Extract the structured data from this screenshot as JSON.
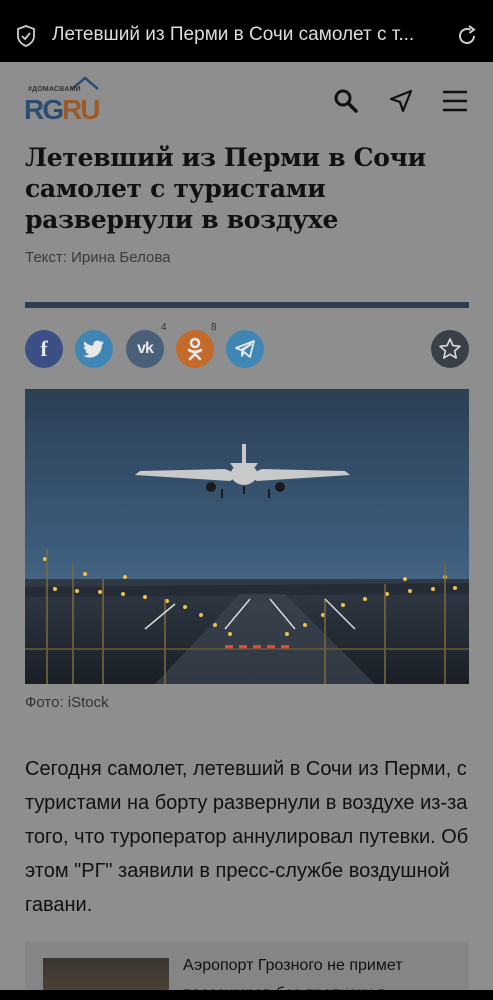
{
  "browser": {
    "tab_title": "Летевший из Перми в Сочи самолет с т..."
  },
  "site": {
    "logo_tag": "#ДОМАСВАМИ",
    "logo_rg": "RG",
    "logo_ru": "RU"
  },
  "article": {
    "headline": "Летевший из Перми в Сочи самолет с туристами развернули в воздухе",
    "byline": "Текст: Ирина Белова",
    "photo_caption": "Фото: iStock",
    "lead": "Сегодня самолет, летевший в Сочи из Перми, с туристами на борту развернули в воздухе из-за того, что туроператор аннулировал путевки. Об этом \"РГ\" заявили в пресс-службе воздушной гавани."
  },
  "share": {
    "vk_count": "4",
    "ok_count": "8",
    "labels": {
      "facebook": "f",
      "vk": "vk",
      "ok": "ok"
    }
  },
  "related": {
    "text": "Аэропорт Грозного не примет пассажиров без прописки в"
  },
  "colors": {
    "facebook": "#3b4f86",
    "twitter": "#3f86b5",
    "vk": "#4a5f78",
    "ok": "#c46a2a",
    "telegram": "#3f86b5",
    "favorite": "#3a4048"
  }
}
